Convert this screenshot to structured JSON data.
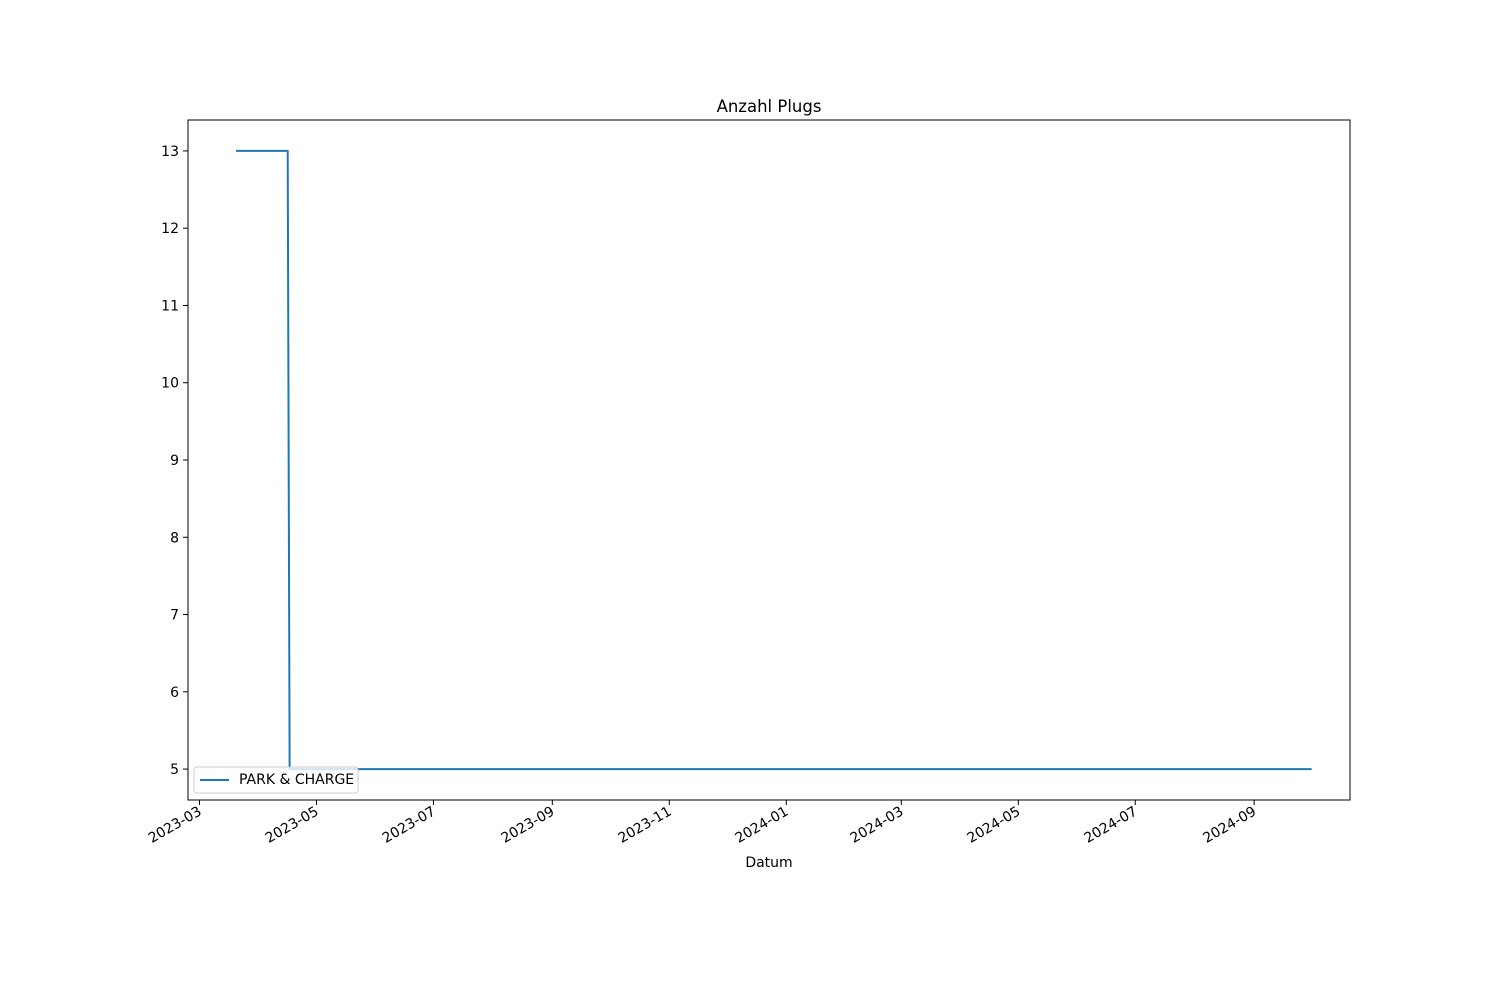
{
  "chart_data": {
    "type": "line",
    "title": "Anzahl Plugs",
    "xlabel": "Datum",
    "ylabel": "",
    "x_type": "date",
    "xlim": [
      "2023-02-23",
      "2024-10-21"
    ],
    "ylim": [
      4.6,
      13.4
    ],
    "x_ticks": [
      "2023-03",
      "2023-05",
      "2023-07",
      "2023-09",
      "2023-11",
      "2024-01",
      "2024-03",
      "2024-05",
      "2024-07",
      "2024-09"
    ],
    "y_ticks": [
      5,
      6,
      7,
      8,
      9,
      10,
      11,
      12,
      13
    ],
    "grid": false,
    "legend_position": "lower left",
    "series": [
      {
        "name": "PARK & CHARGE",
        "color": "#1f77b4",
        "points": [
          {
            "x": "2023-03-20",
            "y": 13
          },
          {
            "x": "2023-04-16",
            "y": 13
          },
          {
            "x": "2023-04-17",
            "y": 5
          },
          {
            "x": "2024-10-01",
            "y": 5
          }
        ]
      }
    ]
  }
}
